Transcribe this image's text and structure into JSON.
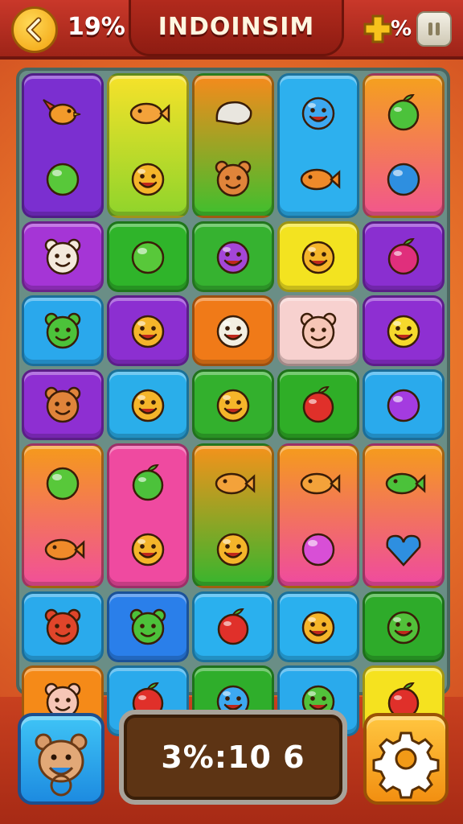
{
  "header": {
    "title": "INDOINSIM",
    "left_percent": "19%",
    "right_percent": "%",
    "back_icon": "chevron-left-icon",
    "bonus_icon": "puzzle-plus-icon",
    "pause_icon": "pause-icon"
  },
  "board": {
    "columns": 5,
    "tiles": [
      {
        "col": 0,
        "row": 0,
        "span": 1,
        "color": "#7b2fd0",
        "color2": "#7b2fd0",
        "items": [
          "bird",
          "green-ball"
        ]
      },
      {
        "col": 1,
        "row": 0,
        "span": 1,
        "color": "#f6e22a",
        "color2": "#8fd42b",
        "items": [
          "fish",
          "smiley"
        ]
      },
      {
        "col": 2,
        "row": 0,
        "span": 1,
        "color": "#f68a1c",
        "color2": "#3fbf2e",
        "items": [
          "rock",
          "monkey"
        ]
      },
      {
        "col": 3,
        "row": 0,
        "span": 1,
        "color": "#2db0ee",
        "color2": "#2db0ee",
        "items": [
          "blue-smiley",
          "orange-fish"
        ]
      },
      {
        "col": 4,
        "row": 0,
        "span": 1,
        "color": "#f5a11d",
        "color2": "#f2568d",
        "items": [
          "green-fruit",
          "blue-ball"
        ]
      },
      {
        "col": 0,
        "row": 1,
        "span": 0.5,
        "color": "#a535d6",
        "color2": "#a535d6",
        "items": [
          "cat"
        ]
      },
      {
        "col": 1,
        "row": 1,
        "span": 0.5,
        "color": "#2fb42a",
        "color2": "#2fb42a",
        "items": [
          "green-ball"
        ]
      },
      {
        "col": 2,
        "row": 1,
        "span": 0.5,
        "color": "#36b230",
        "color2": "#36b230",
        "items": [
          "purple-smiley"
        ]
      },
      {
        "col": 3,
        "row": 1,
        "span": 0.5,
        "color": "#f3e320",
        "color2": "#f3e320",
        "items": [
          "smiley"
        ]
      },
      {
        "col": 4,
        "row": 1,
        "span": 0.5,
        "color": "#8a2fd0",
        "color2": "#8a2fd0",
        "items": [
          "pink-fruit"
        ]
      },
      {
        "col": 0,
        "row": 1.5,
        "span": 0.5,
        "color": "#2aa8ec",
        "color2": "#2aa8ec",
        "items": [
          "frog"
        ]
      },
      {
        "col": 1,
        "row": 1.5,
        "span": 0.5,
        "color": "#8c2fd1",
        "color2": "#8c2fd1",
        "items": [
          "smiley"
        ]
      },
      {
        "col": 2,
        "row": 1.5,
        "span": 0.5,
        "color": "#f07a18",
        "color2": "#f07a18",
        "items": [
          "white-smiley"
        ]
      },
      {
        "col": 3,
        "row": 1.5,
        "span": 0.5,
        "color": "#f7d1cf",
        "color2": "#f7d1cf",
        "items": [
          "pig"
        ]
      },
      {
        "col": 4,
        "row": 1.5,
        "span": 0.5,
        "color": "#8e2fd2",
        "color2": "#8e2fd2",
        "items": [
          "yellow-smiley"
        ]
      },
      {
        "col": 0,
        "row": 2,
        "span": 0.5,
        "color": "#8e2fd2",
        "color2": "#8e2fd2",
        "items": [
          "lion"
        ]
      },
      {
        "col": 1,
        "row": 2,
        "span": 0.5,
        "color": "#2aaeea",
        "color2": "#2aaeea",
        "items": [
          "smiley"
        ]
      },
      {
        "col": 2,
        "row": 2,
        "span": 0.5,
        "color": "#33b02d",
        "color2": "#33b02d",
        "items": [
          "smiley"
        ]
      },
      {
        "col": 3,
        "row": 2,
        "span": 0.5,
        "color": "#2fae27",
        "color2": "#2fae27",
        "items": [
          "red-fruit"
        ]
      },
      {
        "col": 4,
        "row": 2,
        "span": 0.5,
        "color": "#2aaaec",
        "color2": "#2aaaec",
        "items": [
          "purple-ball"
        ]
      },
      {
        "col": 0,
        "row": 2.5,
        "span": 1,
        "color": "#f59a1b",
        "color2": "#f14f9a",
        "items": [
          "green-ball",
          "orange-fish"
        ]
      },
      {
        "col": 1,
        "row": 2.5,
        "span": 1,
        "color": "#ef4aa0",
        "color2": "#ef4aa0",
        "items": [
          "green-fruit",
          "smiley"
        ]
      },
      {
        "col": 2,
        "row": 2.5,
        "span": 1,
        "color": "#f5921b",
        "color2": "#37b52e",
        "items": [
          "fish",
          "smiley"
        ]
      },
      {
        "col": 3,
        "row": 2.5,
        "span": 1,
        "color": "#f59c1b",
        "color2": "#ef4aa0",
        "items": [
          "fish",
          "pink-ball"
        ]
      },
      {
        "col": 4,
        "row": 2.5,
        "span": 1,
        "color": "#f59c1b",
        "color2": "#ef4aa0",
        "items": [
          "green-fish",
          "blue-heart"
        ]
      },
      {
        "col": 0,
        "row": 3.5,
        "span": 0.5,
        "color": "#2aaaec",
        "color2": "#2aaaec",
        "items": [
          "red-bear"
        ]
      },
      {
        "col": 1,
        "row": 3.5,
        "span": 0.5,
        "color": "#2a7fea",
        "color2": "#2a7fea",
        "items": [
          "frog"
        ]
      },
      {
        "col": 2,
        "row": 3.5,
        "span": 0.5,
        "color": "#2ab0ee",
        "color2": "#2ab0ee",
        "items": [
          "red-fruit"
        ]
      },
      {
        "col": 3,
        "row": 3.5,
        "span": 0.5,
        "color": "#2ab0ee",
        "color2": "#2ab0ee",
        "items": [
          "smiley"
        ]
      },
      {
        "col": 4,
        "row": 3.5,
        "span": 0.5,
        "color": "#2eab2a",
        "color2": "#2eab2a",
        "items": [
          "green-smiley"
        ]
      },
      {
        "col": 0,
        "row": 4,
        "span": 0.5,
        "color": "#f58a18",
        "color2": "#f58a18",
        "items": [
          "pig"
        ]
      },
      {
        "col": 1,
        "row": 4,
        "span": 0.5,
        "color": "#2aaaec",
        "color2": "#2aaaec",
        "items": [
          "red-fruit"
        ]
      },
      {
        "col": 2,
        "row": 4,
        "span": 0.5,
        "color": "#2fae2b",
        "color2": "#2fae2b",
        "items": [
          "blue-smiley"
        ]
      },
      {
        "col": 3,
        "row": 4,
        "span": 0.5,
        "color": "#2aaaec",
        "color2": "#2aaaec",
        "items": [
          "green-smiley"
        ]
      },
      {
        "col": 4,
        "row": 4,
        "span": 0.5,
        "color": "#f5e21f",
        "color2": "#f5e21f",
        "items": [
          "red-fruit"
        ]
      }
    ]
  },
  "footer": {
    "score": "3%:10 6",
    "left_button_icon": "pet-icon",
    "settings_icon": "gear-icon"
  }
}
